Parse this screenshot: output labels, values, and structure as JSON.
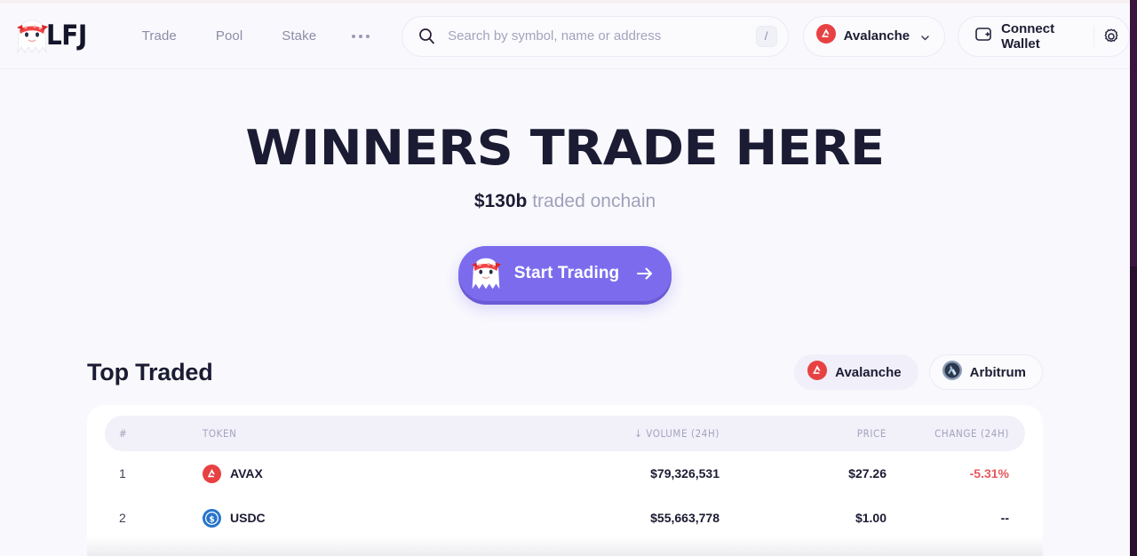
{
  "brand": {
    "logo_text": "LFJ",
    "logo_icon": "ghost-mascot-icon"
  },
  "header": {
    "nav": [
      {
        "label": "Trade",
        "name": "nav-trade"
      },
      {
        "label": "Pool",
        "name": "nav-pool"
      },
      {
        "label": "Stake",
        "name": "nav-stake"
      }
    ],
    "more_icon": "ellipsis-icon",
    "search": {
      "placeholder": "Search by symbol, name or address",
      "value": "",
      "icon": "search-icon",
      "shortcut": "/"
    },
    "chain_selector": {
      "label": "Avalanche",
      "icon": "avalanche-icon",
      "chevron": "chevron-down-icon"
    },
    "wallet": {
      "label": "Connect Wallet",
      "icon": "wallet-icon",
      "settings_icon": "gear-icon"
    }
  },
  "hero": {
    "headline": "WINNERS TRADE HERE",
    "amount": "$130b",
    "subtitle": "traded onchain",
    "cta": {
      "label": "Start Trading",
      "icon": "ghost-mascot-icon",
      "arrow": "arrow-right-icon"
    }
  },
  "top_traded": {
    "title": "Top Traded",
    "chain_filters": [
      {
        "label": "Avalanche",
        "icon": "avalanche-icon",
        "active": true
      },
      {
        "label": "Arbitrum",
        "icon": "arbitrum-icon",
        "active": false
      }
    ],
    "columns": {
      "rank": "#",
      "token": "TOKEN",
      "volume": "↓ VOLUME (24H)",
      "price": "PRICE",
      "change": "CHANGE (24H)"
    },
    "rows": [
      {
        "rank": "1",
        "token": "AVAX",
        "icon": "avalanche-icon",
        "volume": "$79,326,531",
        "price": "$27.26",
        "change": "-5.31%",
        "change_state": "neg"
      },
      {
        "rank": "2",
        "token": "USDC",
        "icon": "usdc-icon",
        "volume": "$55,663,778",
        "price": "$1.00",
        "change": "--",
        "change_state": "flat"
      }
    ]
  },
  "colors": {
    "accent_purple": "#7c6ced",
    "avalanche_red": "#e84142",
    "usdc_blue": "#2775ca",
    "negative_red": "#e8575b",
    "page_bg": "#f9f9fd",
    "header_pill_bg": "#f2f1fa"
  }
}
